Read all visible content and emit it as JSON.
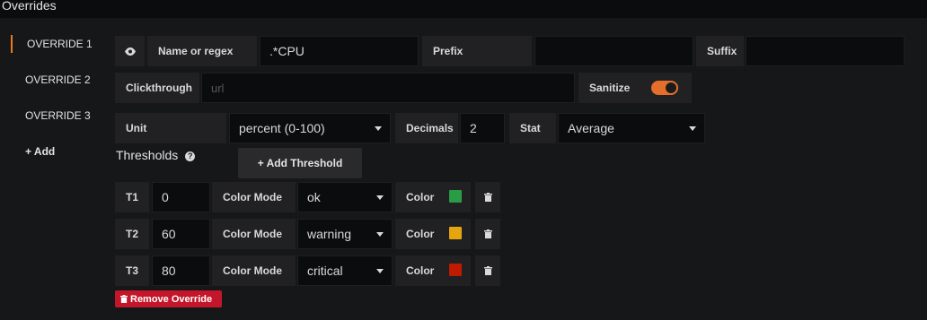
{
  "section_title": "Overrides",
  "tabs": [
    {
      "label": "OVERRIDE 1",
      "active": true
    },
    {
      "label": "OVERRIDE 2",
      "active": false
    },
    {
      "label": "OVERRIDE 3",
      "active": false
    }
  ],
  "add_label": "+ Add",
  "row1": {
    "eye_icon": "eye-icon",
    "name_label": "Name or regex",
    "name_value": ".*CPU",
    "prefix_label": "Prefix",
    "prefix_value": "",
    "suffix_label": "Suffix",
    "suffix_value": ""
  },
  "row2": {
    "clickthrough_label": "Clickthrough",
    "clickthrough_placeholder": "url",
    "sanitize_label": "Sanitize",
    "sanitize_on": true
  },
  "row3": {
    "unit_label": "Unit",
    "unit_value": "percent (0-100)",
    "decimals_label": "Decimals",
    "decimals_value": "2",
    "stat_label": "Stat",
    "stat_value": "Average"
  },
  "thresholds_label": "Thresholds",
  "help_glyph": "?",
  "add_threshold_label": "+ Add Threshold",
  "thresholds": [
    {
      "name": "T1",
      "value": "0",
      "color_mode_label": "Color Mode",
      "color_mode": "ok",
      "color_label": "Color",
      "color": "#299c46"
    },
    {
      "name": "T2",
      "value": "60",
      "color_mode_label": "Color Mode",
      "color_mode": "warning",
      "color_label": "Color",
      "color": "#e5a50f"
    },
    {
      "name": "T3",
      "value": "80",
      "color_mode_label": "Color Mode",
      "color_mode": "critical",
      "color_label": "Color",
      "color": "#bf1b00"
    }
  ],
  "remove_override_label": "Remove Override",
  "colors": {
    "accent": "#eb7b18",
    "danger": "#c4162a"
  }
}
